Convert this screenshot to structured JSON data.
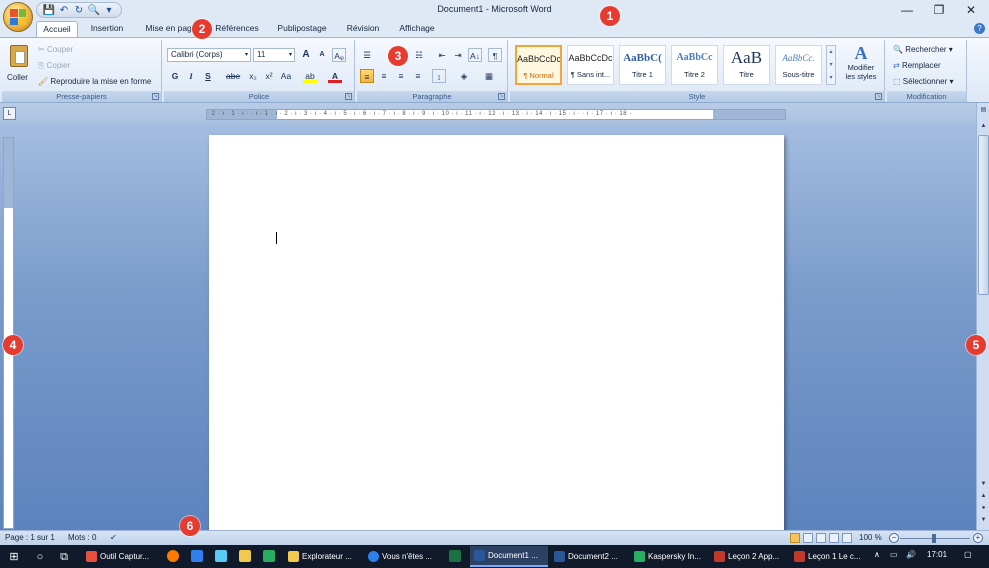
{
  "title_bar": {
    "title": "Document1 - Microsoft Word",
    "minimize": "—",
    "restore": "❐",
    "close": "✕"
  },
  "quick_access": {
    "icons": [
      "save-icon",
      "undo-icon",
      "redo-icon",
      "print-preview-icon",
      "customize-icon"
    ],
    "glyphs": [
      "💾",
      "↶",
      "↻",
      "🔍",
      "▾"
    ]
  },
  "tabs": [
    "Accueil",
    "Insertion",
    "Mise en page",
    "Références",
    "Publipostage",
    "Révision",
    "Affichage"
  ],
  "active_tab": "Accueil",
  "ribbon": {
    "clipboard": {
      "label": "Presse-papiers",
      "paste": "Coller",
      "cut": "Couper",
      "copy": "Copier",
      "format_painter": "Reproduire la mise en forme"
    },
    "font": {
      "label": "Police",
      "font_name": "Calibri (Corps)",
      "font_size": "11",
      "grow": "A",
      "shrink": "A",
      "clear": "Aᵩ",
      "bold": "G",
      "italic": "I",
      "underline": "S",
      "strike": "abe",
      "subscript": "x₂",
      "superscript": "x²",
      "case": "Aa",
      "highlight": "ab",
      "color": "A"
    },
    "paragraph": {
      "label": "Paragraphe",
      "bullets": "☰",
      "numbering": "☷",
      "multilevel": "☵",
      "decrease_indent": "⇤",
      "increase_indent": "⇥",
      "sort": "A↓",
      "show_marks": "¶",
      "align_left": "≡",
      "align_center": "≡",
      "align_right": "≡",
      "justify": "≡",
      "line_spacing": "↕",
      "shading": "◈",
      "borders": "▦"
    },
    "styles": {
      "label": "Style",
      "items": [
        {
          "sample": "AaBbCcDc",
          "name": "¶ Normal"
        },
        {
          "sample": "AaBbCcDc",
          "name": "¶ Sans int..."
        },
        {
          "sample": "AaBbC(",
          "name": "Titre 1"
        },
        {
          "sample": "AaBbCc",
          "name": "Titre 2"
        },
        {
          "sample": "AaB",
          "name": "Titre"
        },
        {
          "sample": "AaBbCc.",
          "name": "Sous-titre"
        }
      ],
      "change_styles_line1": "Modifier",
      "change_styles_line2": "les styles"
    },
    "editing": {
      "label": "Modification",
      "find": "Rechercher",
      "replace": "Remplacer",
      "select": "Sélectionner"
    }
  },
  "ruler": {
    "text": "· 2 · ı · 1 · ı ·  · ı · 1 · ı · 2 · ı · 3 · ı · 4 · ı · 5 · ı · 6 · ı · 7 · ı · 8 · ı · 9 · ı · 10 · ı · 11 · ı · 12 · ı · 13 · ı · 14 · ı · 15 · ı ·  · ı · 17 · ı · 18 ·"
  },
  "status_bar": {
    "page": "Page : 1 sur 1",
    "words": "Mots : 0",
    "zoom": "100 %"
  },
  "taskbar": {
    "items": [
      {
        "label": "Outil Captur...",
        "color": "#e7503c"
      },
      {
        "label": "Explorateur ...",
        "color": "#f2c94c"
      },
      {
        "label": "Vous n'êtes ...",
        "color": "#2f80ed"
      },
      {
        "label": "Document1 ...",
        "color": "#2b579a",
        "active": true
      },
      {
        "label": "Document2 ...",
        "color": "#2b579a"
      },
      {
        "label": "Kaspersky In...",
        "color": "#27ae60"
      },
      {
        "label": "Leçon 2 App...",
        "color": "#c0392b"
      },
      {
        "label": "Leçon 1 Le c...",
        "color": "#c0392b"
      }
    ],
    "time": "17:01"
  },
  "callouts": [
    "1",
    "2",
    "3",
    "4",
    "5",
    "6"
  ],
  "colors": {
    "accent": "#2b579a",
    "callout": "#e63b2e",
    "selected_style": "#f2a63a"
  }
}
